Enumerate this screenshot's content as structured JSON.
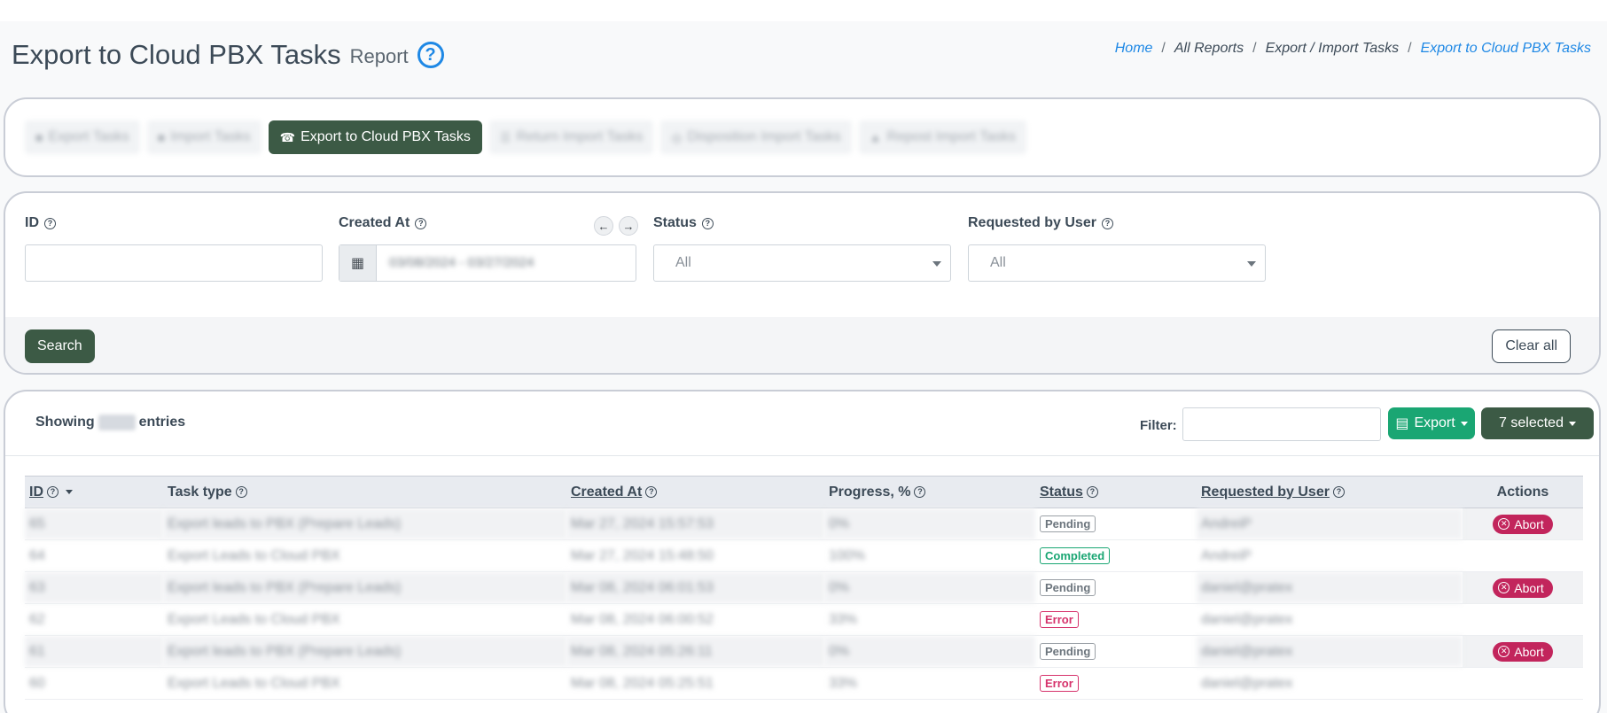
{
  "header": {
    "title": "Export to Cloud PBX Tasks",
    "subtitle": "Report",
    "help": "?"
  },
  "breadcrumb": {
    "home": "Home",
    "all_reports": "All Reports",
    "export_import": "Export / Import Tasks",
    "current": "Export to Cloud PBX Tasks",
    "separator": "/"
  },
  "tabs": [
    {
      "label": "Export Tasks",
      "icon": "■"
    },
    {
      "label": "Import Tasks",
      "icon": "■"
    },
    {
      "label": "Export to Cloud PBX Tasks",
      "icon": "☎"
    },
    {
      "label": "Return Import Tasks",
      "icon": "☰"
    },
    {
      "label": "Disposition Import Tasks",
      "icon": "◎"
    },
    {
      "label": "Repost Import Tasks",
      "icon": "▲"
    }
  ],
  "filters": {
    "id_label": "ID",
    "created_label": "Created At",
    "created_value": "03/08/2024 - 03/27/2024",
    "status_label": "Status",
    "status_value": "All",
    "user_label": "Requested by User",
    "user_value": "All",
    "prev": "←",
    "next": "→",
    "search": "Search",
    "clear_all": "Clear all"
  },
  "table_toolbar": {
    "showing": "Showing",
    "entries": "entries",
    "filter_label": "Filter:",
    "export": "Export",
    "selected": "7 selected"
  },
  "columns": {
    "id": "ID",
    "task_type": "Task type",
    "created_at": "Created At",
    "progress": "Progress, %",
    "status": "Status",
    "user": "Requested by User",
    "actions": "Actions"
  },
  "rows": [
    {
      "id": "65",
      "type": "Export leads to PBX (Prepare Leads)",
      "created": "Mar 27, 2024 15:57:53",
      "progress": "0%",
      "status": "Pending",
      "status_kind": "pending",
      "user": "AndreiP",
      "action": "Abort"
    },
    {
      "id": "64",
      "type": "Export Leads to Cloud PBX",
      "created": "Mar 27, 2024 15:48:50",
      "progress": "100%",
      "status": "Completed",
      "status_kind": "completed",
      "user": "AndreiP",
      "action": ""
    },
    {
      "id": "63",
      "type": "Export leads to PBX (Prepare Leads)",
      "created": "Mar 08, 2024 06:01:53",
      "progress": "0%",
      "status": "Pending",
      "status_kind": "pending",
      "user": "daniel@pratex",
      "action": "Abort"
    },
    {
      "id": "62",
      "type": "Export Leads to Cloud PBX",
      "created": "Mar 08, 2024 06:00:52",
      "progress": "33%",
      "status": "Error",
      "status_kind": "error",
      "user": "daniel@pratex",
      "action": ""
    },
    {
      "id": "61",
      "type": "Export leads to PBX (Prepare Leads)",
      "created": "Mar 08, 2024 05:26:11",
      "progress": "0%",
      "status": "Pending",
      "status_kind": "pending",
      "user": "daniel@pratex",
      "action": "Abort"
    },
    {
      "id": "60",
      "type": "Export Leads to Cloud PBX",
      "created": "Mar 08, 2024 05:25:51",
      "progress": "33%",
      "status": "Error",
      "status_kind": "error",
      "user": "daniel@pratex",
      "action": ""
    }
  ]
}
